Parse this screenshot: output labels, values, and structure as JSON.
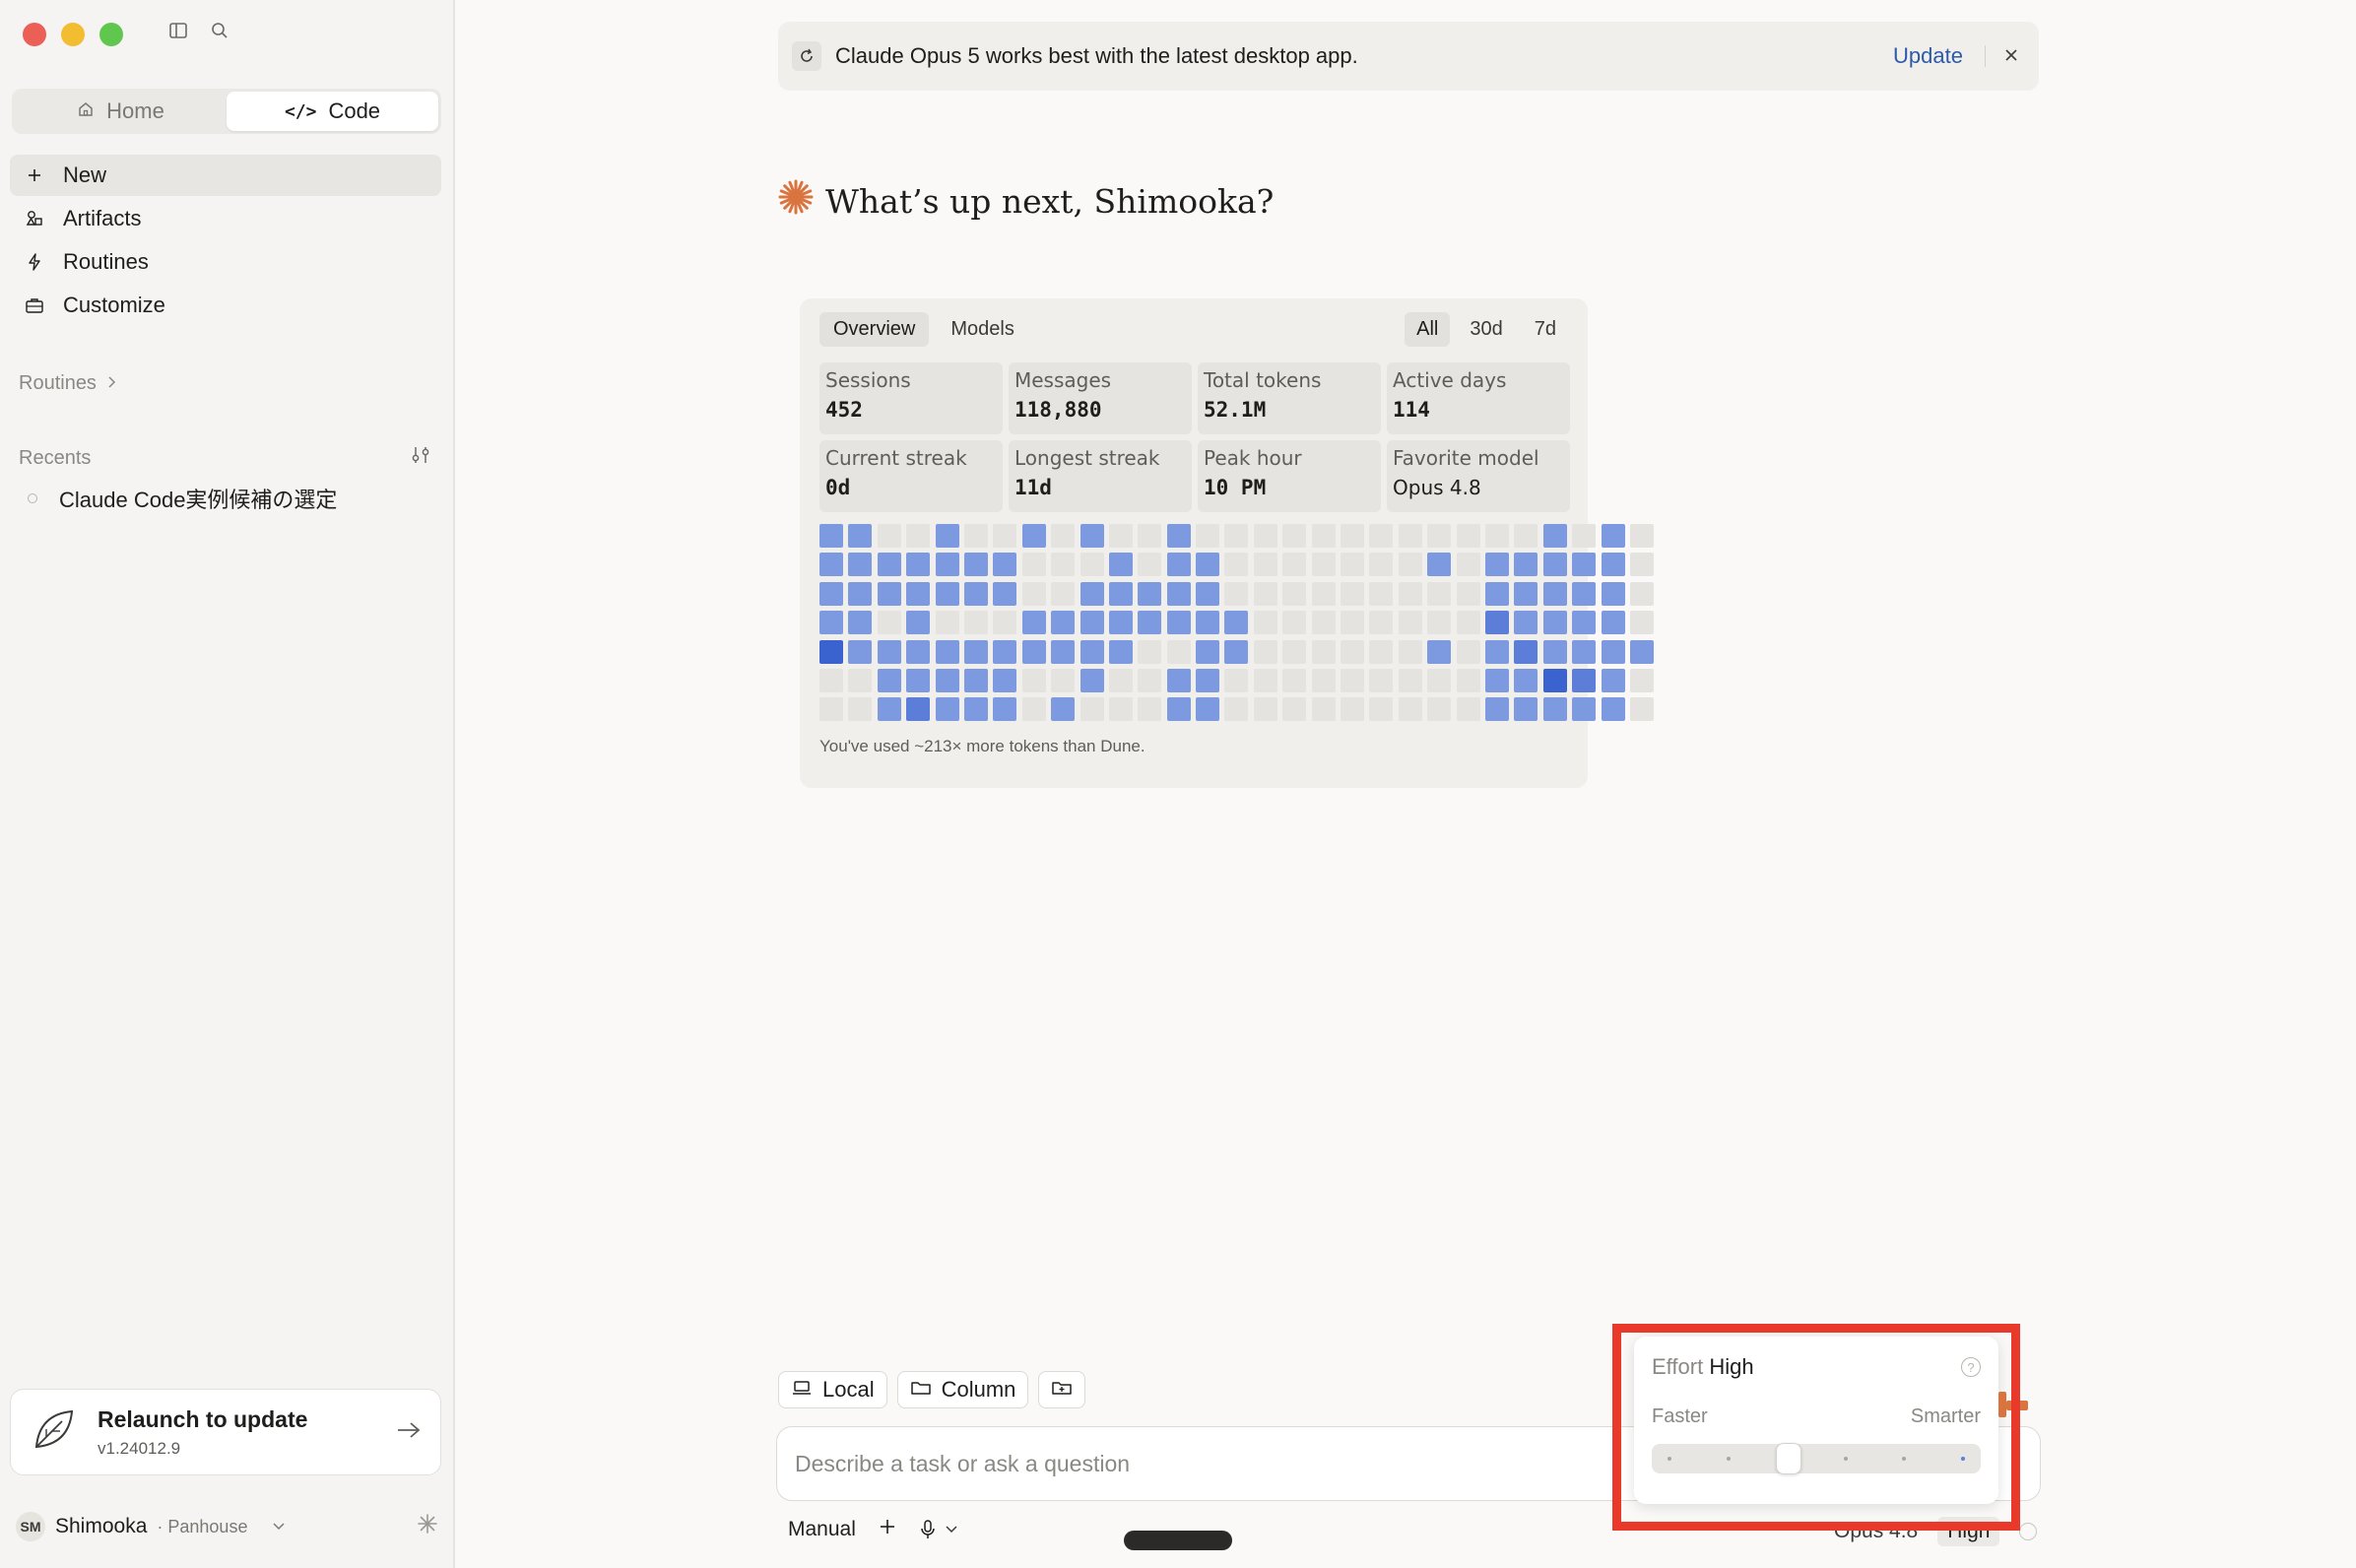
{
  "sidebar": {
    "segments": [
      {
        "label": "Home",
        "icon": "house-icon",
        "active": false
      },
      {
        "label": "Code",
        "icon": "code-icon",
        "active": true
      }
    ],
    "nav": [
      {
        "label": "New",
        "icon": "plus-icon",
        "active": true
      },
      {
        "label": "Artifacts",
        "icon": "artifacts-icon",
        "active": false
      },
      {
        "label": "Routines",
        "icon": "bolt-icon",
        "active": false
      },
      {
        "label": "Customize",
        "icon": "briefcase-icon",
        "active": false
      }
    ],
    "routines_label": "Routines",
    "recents_label": "Recents",
    "recents": [
      "Claude Code実例候補の選定"
    ],
    "update_card": {
      "title": "Relaunch to update",
      "version": "v1.24012.9"
    },
    "user": {
      "initials": "SM",
      "name": "Shimooka",
      "org": "· Panhouse"
    }
  },
  "banner": {
    "message": "Claude Opus 5 works best with the latest desktop app.",
    "action": "Update"
  },
  "greeting": "What’s up next, Shimooka?",
  "stats": {
    "tabs": [
      "Overview",
      "Models"
    ],
    "active_tab": "Overview",
    "ranges": [
      "All",
      "30d",
      "7d"
    ],
    "active_range": "All",
    "cards": [
      {
        "label": "Sessions",
        "value": "452"
      },
      {
        "label": "Messages",
        "value": "118,880"
      },
      {
        "label": "Total tokens",
        "value": "52.1M"
      },
      {
        "label": "Active days",
        "value": "114"
      },
      {
        "label": "Current streak",
        "value": "0d"
      },
      {
        "label": "Longest streak",
        "value": "11d"
      },
      {
        "label": "Peak hour",
        "value": "10 PM"
      },
      {
        "label": "Favorite model",
        "value": "Opus 4.8"
      }
    ],
    "footnote": "You've used ~213× more tokens than Dune.",
    "heatmap_rows": [
      "22002002020020000000000002020",
      "22222220002022000000020222220",
      "22222220022222000000000222220",
      "22020002222222200000000322220",
      "42222222222002200000020232222",
      "00222220020022000000000224320",
      "00232220200022000000000222220"
    ],
    "colors": {
      "empty": "#e4e3e0",
      "light": "#9db2e6",
      "mid": "#7d99e0",
      "strong": "#5c7ed8",
      "max": "#3a63cf"
    }
  },
  "composer": {
    "chips": [
      {
        "label": "Local",
        "icon": "laptop-icon"
      },
      {
        "label": "Column",
        "icon": "folder-icon"
      },
      {
        "label": "",
        "icon": "folder-plus-icon"
      }
    ],
    "placeholder": "Describe a task or ask a question",
    "mode": "Manual",
    "model": "Opus 4.8",
    "effort_pill": "High"
  },
  "effort_popover": {
    "label": "Effort",
    "value": "High",
    "min_label": "Faster",
    "max_label": "Smarter",
    "steps": 6,
    "selected_step": 3
  },
  "accent": "#e8392a"
}
